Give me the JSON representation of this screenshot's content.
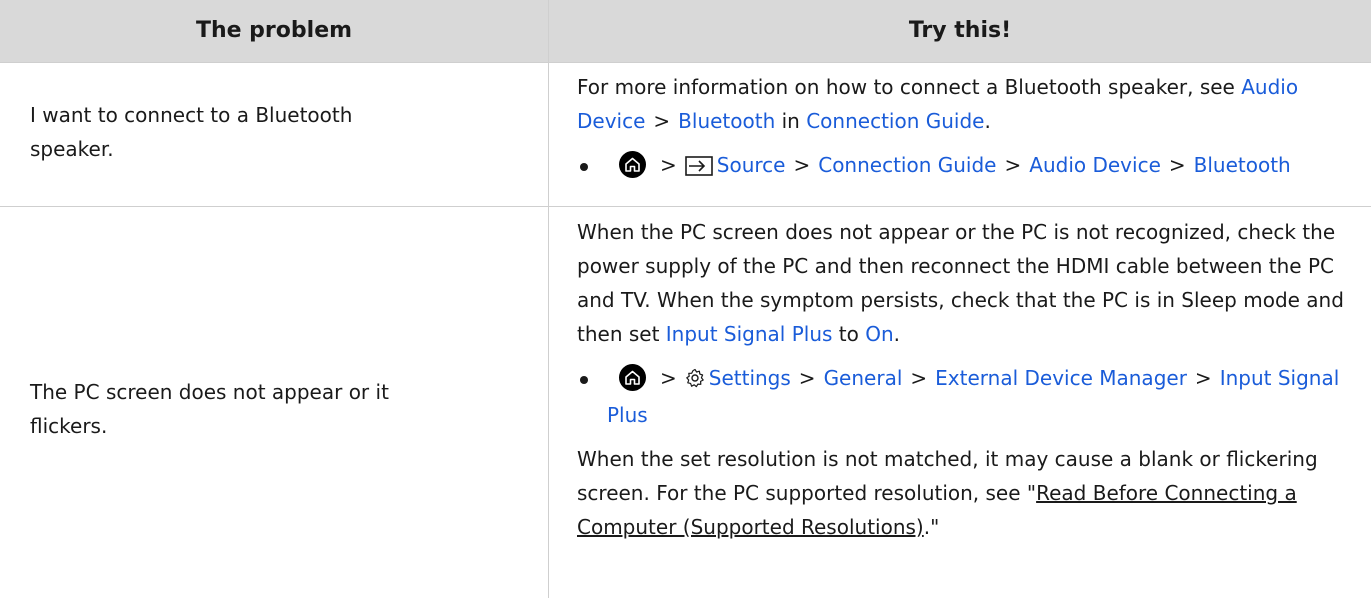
{
  "header": {
    "col1": "The problem",
    "col2": "Try this!"
  },
  "rows": [
    {
      "problem": "I want to connect to a Bluetooth speaker.",
      "para1": {
        "before": "For more information on how to connect a Bluetooth speaker, see ",
        "link1": "Audio Device",
        "chevron": ">",
        "link2": "Bluetooth",
        "mid": " in ",
        "link3": "Connection Guide",
        "after": "."
      },
      "path": {
        "chevron": ">",
        "items": [
          "Source",
          "Connection Guide",
          "Audio Device",
          "Bluetooth"
        ]
      }
    },
    {
      "problem": "The PC screen does not appear or it flickers.",
      "para1": {
        "text": "When the PC screen does not appear or the PC is not recognized, check the power supply of the PC and then reconnect the HDMI cable between the PC and TV. When the symptom persists, check that the PC is in Sleep mode and then set ",
        "link1": "Input Signal Plus",
        "mid": " to ",
        "link2": "On",
        "after": "."
      },
      "path": {
        "chevron": ">",
        "items": [
          "Settings",
          "General",
          "External Device Manager",
          "Input Signal Plus"
        ]
      },
      "para2": {
        "text": "When the set resolution is not matched, it may cause a blank or flickering screen. For the PC supported resolution, see \"",
        "link": "Read Before Connecting a Computer (Supported Resolutions)",
        "after": ".\""
      }
    }
  ],
  "icons": {
    "home": "home-icon",
    "source": "source-input-icon",
    "settings": "gear-icon"
  },
  "colors": {
    "link": "#1a5cd9",
    "header_bg": "#d9d9d9",
    "text": "#1a1a1a"
  }
}
